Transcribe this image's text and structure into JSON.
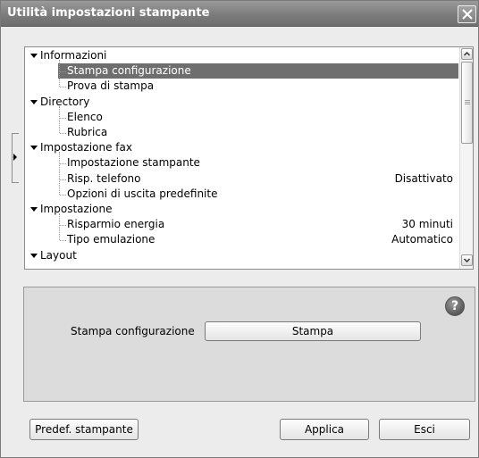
{
  "window": {
    "title": "Utilità impostazioni stampante"
  },
  "tree": {
    "groups": [
      {
        "label": "Informazioni",
        "children": [
          {
            "label": "Stampa configurazione",
            "value": "",
            "selected": true
          },
          {
            "label": "Prova di stampa",
            "value": ""
          }
        ]
      },
      {
        "label": "Directory",
        "children": [
          {
            "label": "Elenco",
            "value": ""
          },
          {
            "label": "Rubrica",
            "value": ""
          }
        ]
      },
      {
        "label": "Impostazione fax",
        "children": [
          {
            "label": "Impostazione stampante",
            "value": ""
          },
          {
            "label": "Risp. telefono",
            "value": "Disattivato"
          },
          {
            "label": "Opzioni di uscita predefinite",
            "value": ""
          }
        ]
      },
      {
        "label": "Impostazione",
        "children": [
          {
            "label": "Risparmio energia",
            "value": "30 minuti"
          },
          {
            "label": "Tipo emulazione",
            "value": "Automatico"
          }
        ]
      },
      {
        "label": "Layout",
        "children": []
      }
    ]
  },
  "detail": {
    "label": "Stampa configurazione",
    "button": "Stampa"
  },
  "footer": {
    "defaults_button": "Predef. stampante",
    "apply_button": "Applica",
    "exit_button": "Esci"
  },
  "colors": {
    "selection": "#6e6e6e",
    "titlebar": "#7c7c7c"
  }
}
